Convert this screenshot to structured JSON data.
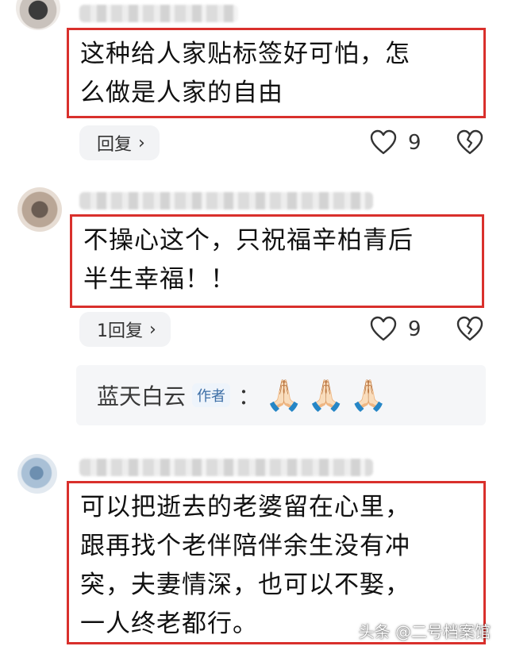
{
  "comments": [
    {
      "text_line1": "这种给人家贴标签好可怕，怎",
      "text_line2": "么做是人家的自由",
      "reply_label": "回复",
      "like_count": "9"
    },
    {
      "text_line1": "不操心这个，只祝福辛柏青后",
      "text_line2": "半生幸福！！",
      "reply_label": "1回复",
      "like_count": "9",
      "sub_reply": {
        "author": "蓝天白云",
        "badge": "作者",
        "colon": "：",
        "emojis": [
          "🙏🏻",
          "🙏🏻",
          "🙏🏻"
        ]
      }
    },
    {
      "text_line1": "可以把逝去的老婆留在心里，",
      "text_line2": "跟再找个老伴陪伴余生没有冲",
      "text_line3": "突，夫妻情深，也可以不娶，",
      "text_line4": "一人终老都行。"
    }
  ],
  "icons": {
    "chevron": "›",
    "like": "heart-outline-icon",
    "dislike": "broken-heart-icon"
  },
  "colors": {
    "highlight_border": "#d9302c",
    "pill_bg": "#f2f3f5",
    "badge_text": "#3c6ea6"
  },
  "watermark": "头条 @二号档案馆"
}
